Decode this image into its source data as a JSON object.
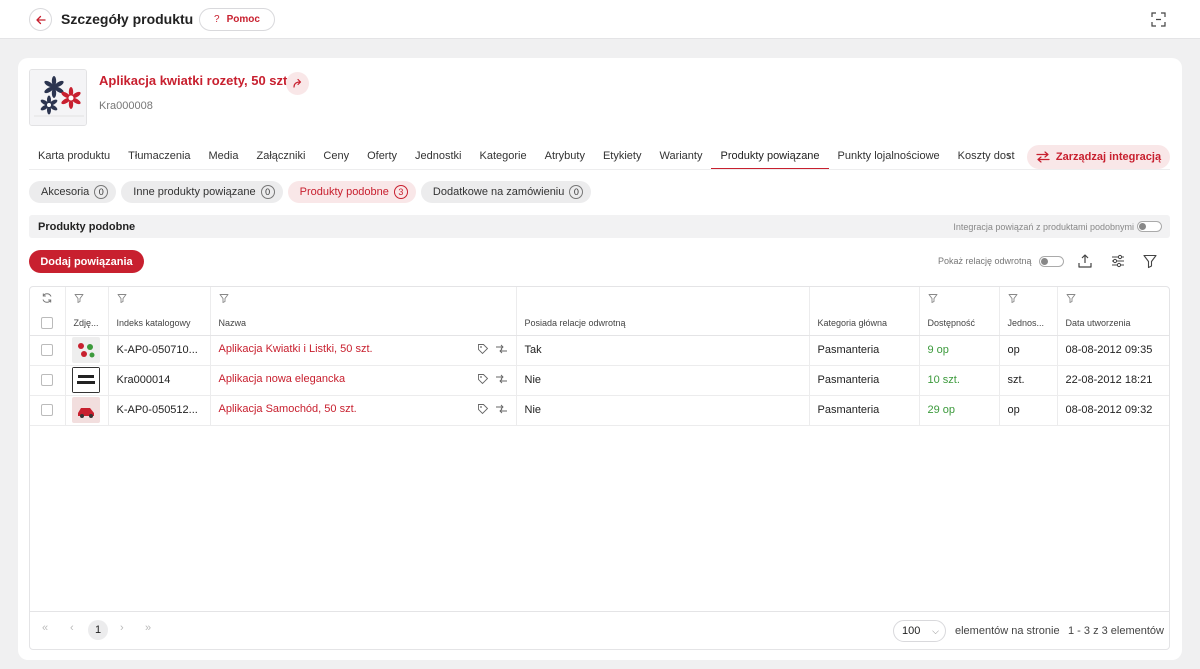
{
  "header": {
    "title": "Szczegóły produktu",
    "help_label": "Pomoc",
    "help_icon_text": "?"
  },
  "product": {
    "name": "Aplikacja kwiatki rozety, 50 szt.",
    "sku": "Kra000008"
  },
  "tabs": [
    {
      "label": "Karta produktu",
      "active": false
    },
    {
      "label": "Tłumaczenia",
      "active": false
    },
    {
      "label": "Media",
      "active": false
    },
    {
      "label": "Załączniki",
      "active": false
    },
    {
      "label": "Ceny",
      "active": false
    },
    {
      "label": "Oferty",
      "active": false
    },
    {
      "label": "Jednostki",
      "active": false
    },
    {
      "label": "Kategorie",
      "active": false
    },
    {
      "label": "Atrybuty",
      "active": false
    },
    {
      "label": "Etykiety",
      "active": false
    },
    {
      "label": "Warianty",
      "active": false
    },
    {
      "label": "Produkty powiązane",
      "active": true
    },
    {
      "label": "Punkty lojalnościowe",
      "active": false
    },
    {
      "label": "Koszty dostawy",
      "active": false
    }
  ],
  "integration_button": "Zarządzaj integracją",
  "subtabs": [
    {
      "label": "Akcesoria",
      "count": "0",
      "active": false
    },
    {
      "label": "Inne produkty powiązane",
      "count": "0",
      "active": false
    },
    {
      "label": "Produkty podobne",
      "count": "3",
      "active": true
    },
    {
      "label": "Dodatkowe na zamówieniu",
      "count": "0",
      "active": false
    }
  ],
  "section": {
    "title": "Produkty podobne",
    "toggle_label": "Integracja powiązań z produktami podobnymi"
  },
  "add_button": "Dodaj powiązania",
  "reverse_toggle_label": "Pokaż relację odwrotną",
  "table": {
    "columns": [
      "Zdję...",
      "Indeks katalogowy",
      "Nazwa",
      "Posiada relacje odwrotną",
      "Kategoria główna",
      "Dostępność",
      "Jednos...",
      "Data utworzenia"
    ],
    "rows": [
      {
        "index": "K-AP0-050710...",
        "name": "Aplikacja Kwiatki i Listki, 50 szt.",
        "reverse": "Tak",
        "category": "Pasmanteria",
        "availability": "9 op",
        "unit": "op",
        "created": "08-08-2012 09:35"
      },
      {
        "index": "Kra000014",
        "name": "Aplikacja nowa elegancka",
        "reverse": "Nie",
        "category": "Pasmanteria",
        "availability": "10 szt.",
        "unit": "szt.",
        "created": "22-08-2012 18:21"
      },
      {
        "index": "K-AP0-050512...",
        "name": "Aplikacja Samochód, 50 szt.",
        "reverse": "Nie",
        "category": "Pasmanteria",
        "availability": "29 op",
        "unit": "op",
        "created": "08-08-2012 09:32"
      }
    ]
  },
  "pagination": {
    "current_page": "1",
    "per_page": "100",
    "per_page_label": "elementów na stronie",
    "range_label": "1 - 3 z 3 elementów"
  },
  "colors": {
    "accent": "#c8202f",
    "available": "#3c9a3c"
  }
}
